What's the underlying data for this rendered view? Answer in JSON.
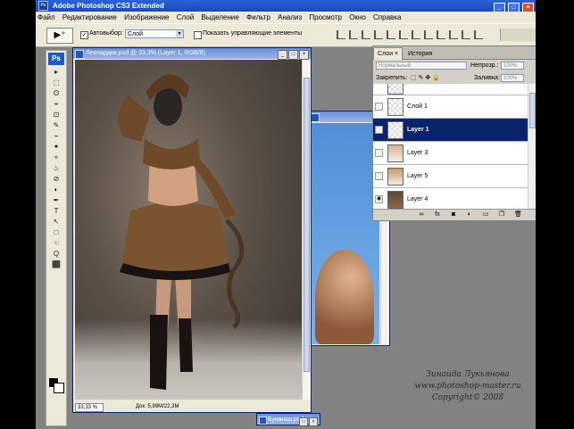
{
  "app": {
    "title": "Adobe Photoshop CS3 Extended",
    "logo": "Ps",
    "window_buttons": [
      "_",
      "□",
      "×"
    ]
  },
  "menu": [
    "Файл",
    "Редактирование",
    "Изображение",
    "Слой",
    "Выделение",
    "Фильтр",
    "Анализ",
    "Просмотр",
    "Окно",
    "Справка"
  ],
  "options": {
    "tool_preset": "▶⁺",
    "autoselect_label": "Автовыбор:",
    "autoselect_checked": "✓",
    "autoselect_value": "Слой",
    "show_controls_label": "Показать управляющие элементы"
  },
  "toolbox": {
    "logo": "Ps",
    "tools": [
      "▸",
      "⬚",
      "ʘ",
      "⌖",
      "⊡",
      "✎",
      "⌁",
      "✦",
      "✧",
      "♨",
      "⊘",
      "◐",
      "✒",
      "T",
      "↖",
      "□",
      "☜",
      "Q",
      "⬛"
    ]
  },
  "documents": {
    "main": {
      "title": "Леопардик.psd @ 33,3% (Layer 1, RGB/8)",
      "zoom": "33,33 %",
      "doc_info": "Док: 5,99M/22,3M"
    },
    "second": {
      "title": ""
    },
    "minimized": {
      "title": "Буммаш.psd"
    }
  },
  "layers_panel": {
    "tabs": [
      "Слои ×",
      "История"
    ],
    "close": "×",
    "blend_mode": "Нормальный",
    "opacity_label": "Непрозр.:",
    "opacity_value": "100%",
    "lock_label": "Закрепить:",
    "fill_label": "Заливка:",
    "fill_value": "100%",
    "layers": [
      {
        "name": "",
        "visible": false,
        "selected": false,
        "thumb": "transparent"
      },
      {
        "name": "Слой 1",
        "visible": false,
        "selected": false,
        "thumb": "transparent"
      },
      {
        "name": "Layer 1",
        "visible": false,
        "selected": true,
        "thumb": "transparent"
      },
      {
        "name": "Layer 3",
        "visible": false,
        "selected": false,
        "thumb": "transparent"
      },
      {
        "name": "Layer 5",
        "visible": false,
        "selected": false,
        "thumb": "transparent"
      },
      {
        "name": "Layer 4",
        "visible": true,
        "selected": false,
        "thumb": "photo"
      }
    ],
    "bottom_icons": [
      "link-icon",
      "fx-icon",
      "mask-icon",
      "adjustment-icon",
      "group-icon",
      "new-layer-icon",
      "trash-icon"
    ]
  },
  "watermark": {
    "line1": "Зинаида Лукьянова",
    "line2": "www.photoshop-master.ru",
    "line3": "Copyright© 2008"
  }
}
